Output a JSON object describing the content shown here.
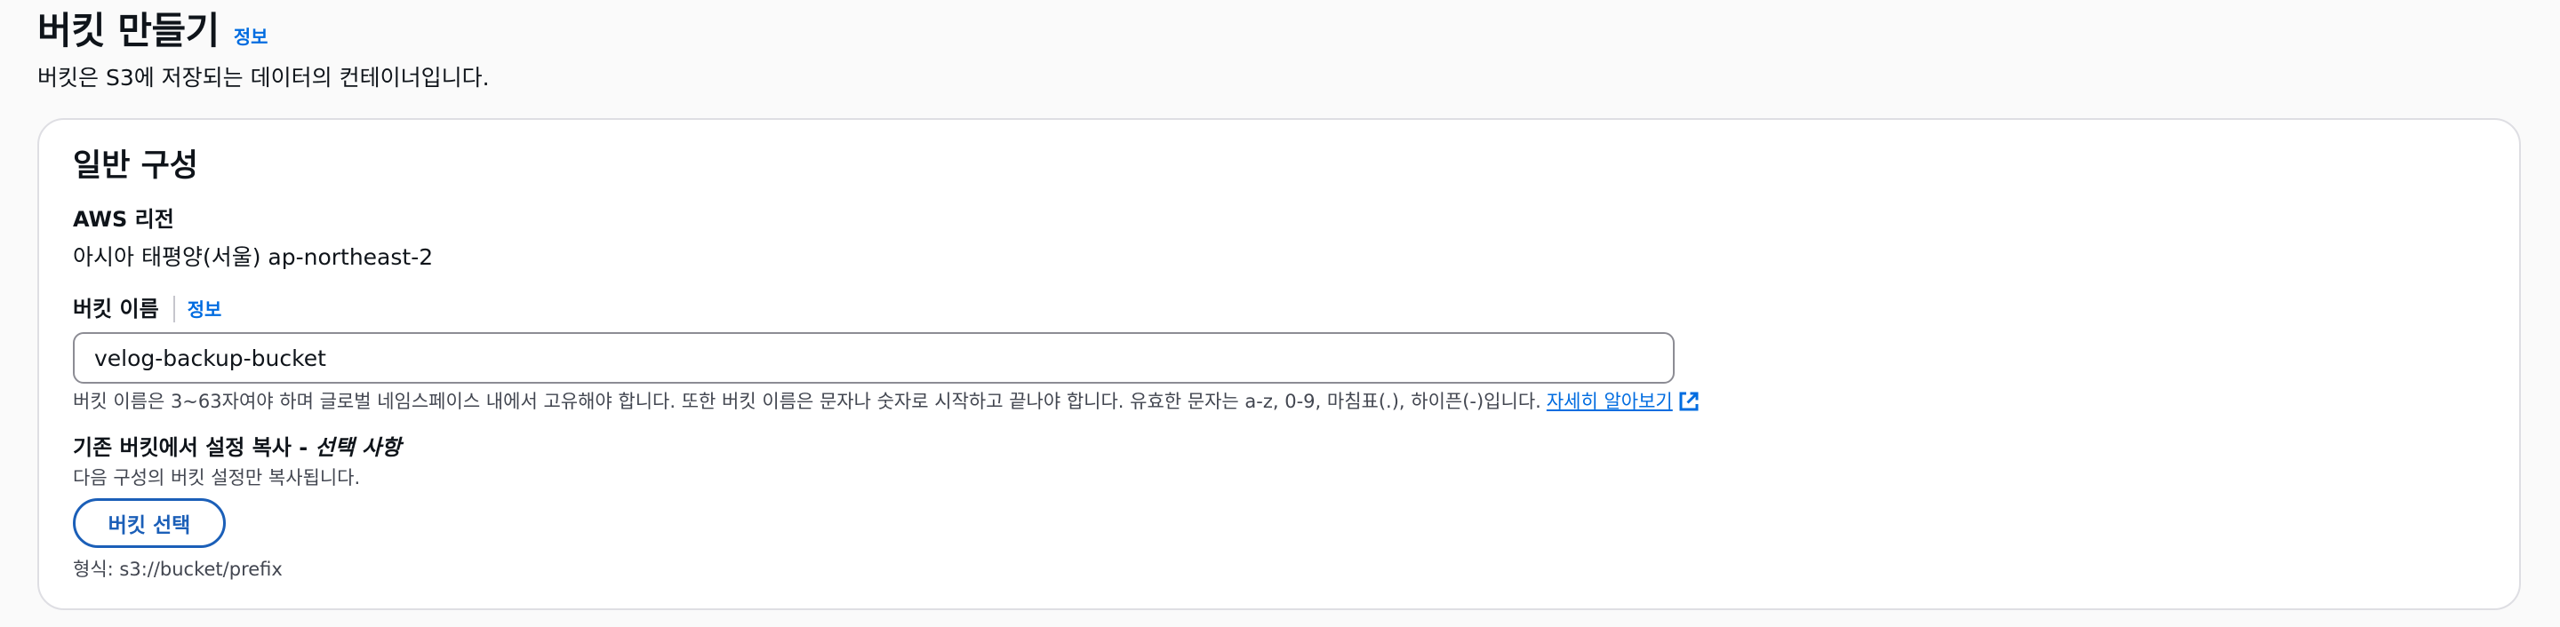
{
  "header": {
    "title": "버킷 만들기",
    "info_label": "정보",
    "description": "버킷은 S3에 저장되는 데이터의 컨테이너입니다."
  },
  "general_config": {
    "title": "일반 구성",
    "region": {
      "label": "AWS 리전",
      "value": "아시아 태평양(서울) ap-northeast-2"
    },
    "bucket_name": {
      "label": "버킷 이름",
      "info_label": "정보",
      "value": "velog-backup-bucket",
      "constraint_text": "버킷 이름은 3~63자여야 하며 글로벌 네임스페이스 내에서 고유해야 합니다. 또한 버킷 이름은 문자나 숫자로 시작하고 끝나야 합니다. 유효한 문자는 a-z, 0-9, 마침표(.), 하이픈(-)입니다.",
      "learn_more_label": "자세히 알아보기",
      "learn_more_icon": "external-link-icon"
    },
    "copy_settings": {
      "label": "기존 버킷에서 설정 복사 - ",
      "optional_label": "선택 사항",
      "description": "다음 구성의 버킷 설정만 복사됩니다.",
      "button_label": "버킷 선택",
      "format_hint": "형식: s3://bucket/prefix"
    }
  },
  "colors": {
    "link": "#006ce0",
    "button_border": "#1b5fb8",
    "card_border": "#dedee3",
    "background": "#fafafa"
  }
}
